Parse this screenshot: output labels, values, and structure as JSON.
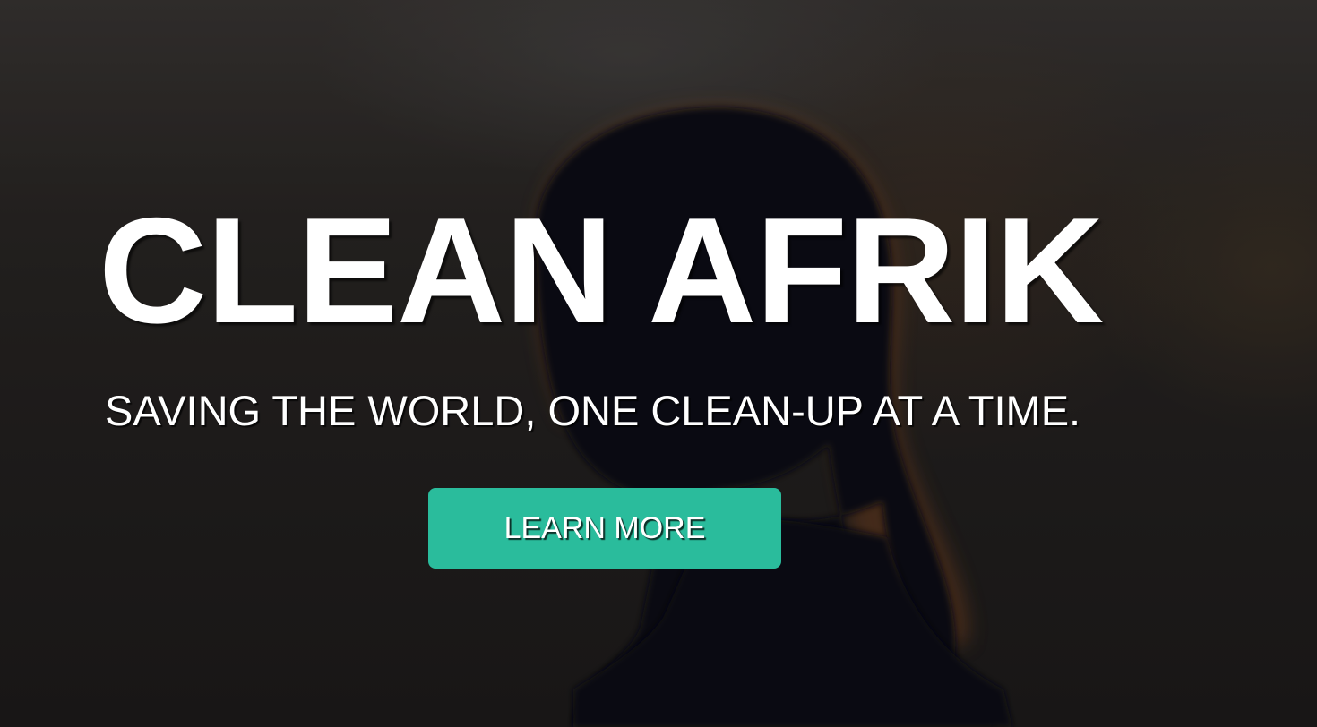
{
  "hero": {
    "title": "CLEAN AFRIK",
    "subtitle": "SAVING THE WORLD, ONE CLEAN-UP AT A TIME.",
    "button_label": "LEARN MORE",
    "background_image": "silhouette of a person with hair tied back against a dark blurred backdrop",
    "accent_color": "#2abc9c",
    "text_color": "#ffffff"
  }
}
